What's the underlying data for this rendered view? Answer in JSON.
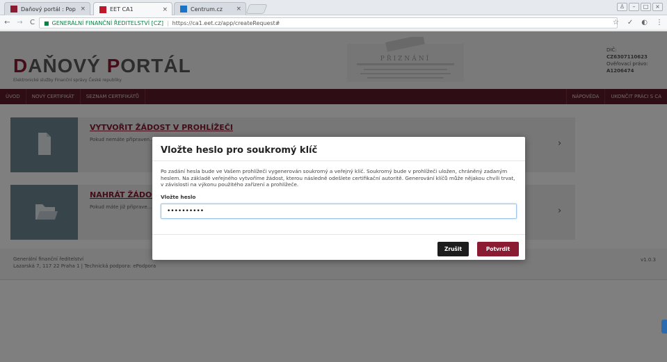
{
  "browser": {
    "tabs": [
      {
        "title": "Daňový portál : Poplatn",
        "close": "×"
      },
      {
        "title": "EET CA1",
        "close": "×"
      },
      {
        "title": "Centrum.cz",
        "close": "×"
      }
    ],
    "address": {
      "secure_label": "GENERÁLNÍ FINANČNÍ ŘEDITELSTVÍ [CZ]",
      "separator": "|",
      "url": "https://ca1.eet.cz/app/createRequest#"
    },
    "icons": [
      "back-arrow-icon",
      "forward-arrow-icon",
      "reload-icon",
      "lock-icon",
      "star-icon",
      "menu-icon"
    ]
  },
  "header": {
    "logo_first_letter": "D",
    "logo_first_rest": "AŇOVÝ ",
    "logo_second_letter": "P",
    "logo_second_rest": "ORTÁL",
    "logo_sub": "Elektronické služby Finanční správy České republiky",
    "stamp_text": "PŘIZNÁNÍ",
    "user": {
      "dic_label": "DIČ:",
      "dic": "CZ6307110623",
      "auth_label": "Ověřovací právo:",
      "auth": "A1206474"
    }
  },
  "menu": {
    "left": [
      "ÚVOD",
      "NOVÝ CERTIFIKÁT",
      "SEZNAM CERTIFIKÁTŮ"
    ],
    "right": [
      "NÁPOVĚDA",
      "UKONČIT PRÁCI S CA"
    ]
  },
  "cards": [
    {
      "title": "VYTVOŘIT ŽÁDOST V PROHLÍŽEČI",
      "text": "Pokud nemáte připraven... klíč bude použit k připoj... použití."
    },
    {
      "title": "NAHRÁT ŽÁDOST",
      "text": "Pokud máte již připrave... bitů. Z žádosti bude vyt..."
    }
  ],
  "footer": {
    "line1": "Generální finanční ředitelství",
    "line2": "Lazarská 7, 117 22 Praha 1 | Technická podpora: ePodpora",
    "version": "v1.0.3"
  },
  "modal": {
    "title": "Vložte heslo pro soukromý klíč",
    "text": "Po zadání hesla bude ve Vašem prohlížeči vygenerován soukromý a veřejný klíč. Soukromý bude v prohlížeči uložen, chráněný zadaným heslem. Na základě veřejného vytvoříme žádost, kterou následně odešlete certifikační autoritě. Generování klíčů může nějakou chvíli trvat, v závislosti na výkonu použitého zařízení a prohlížeče.",
    "field_label": "Vložte heslo",
    "field_value": "••••••••••",
    "cancel": "Zrušit",
    "confirm": "Potvrdit"
  },
  "colors": {
    "brand": "#8b1a33",
    "menu": "#5c1a2b"
  }
}
